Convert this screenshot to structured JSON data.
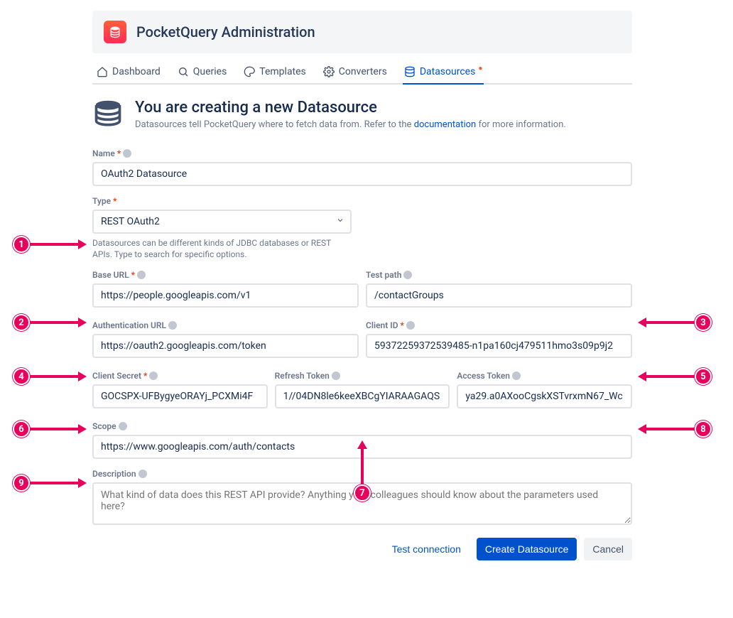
{
  "app": {
    "title": "PocketQuery Administration"
  },
  "tabs": {
    "dashboard": "Dashboard",
    "queries": "Queries",
    "templates": "Templates",
    "converters": "Converters",
    "datasources": "Datasources"
  },
  "intro": {
    "title": "You are creating a new Datasource",
    "sub_pre": "Datasources tell PocketQuery where to fetch data from. Refer to the ",
    "sub_link": "documentation",
    "sub_post": " for more information."
  },
  "labels": {
    "name": "Name",
    "type": "Type",
    "baseurl": "Base URL",
    "testpath": "Test path",
    "authurl": "Authentication URL",
    "clientid": "Client ID",
    "clientsecret": "Client Secret",
    "refreshtoken": "Refresh Token",
    "accesstoken": "Access Token",
    "scope": "Scope",
    "description": "Description"
  },
  "values": {
    "name": "OAuth2 Datasource",
    "type": "REST OAuth2",
    "type_help": "Datasources can be different kinds of JDBC databases or REST APIs. Type to search for specific options.",
    "baseurl": "https://people.googleapis.com/v1",
    "testpath": "/contactGroups",
    "authurl": "https://oauth2.googleapis.com/token",
    "clientid": "59372259372539485-n1pa160cj479511hmo3s09p9j2",
    "clientsecret": "GOCSPX-UFBygyeORAYj_PCXMi4F",
    "refreshtoken": "1//04DN8le6keeXBCgYIARAAGAQS",
    "accesstoken": "ya29.a0AXooCgskXSTvrxmN67_Wc",
    "scope": "https://www.googleapis.com/auth/contacts",
    "description_placeholder": "What kind of data does this REST API provide? Anything your colleagues should know about the parameters used here?"
  },
  "actions": {
    "test": "Test connection",
    "create": "Create Datasource",
    "cancel": "Cancel"
  },
  "annotations": [
    "1",
    "2",
    "3",
    "4",
    "5",
    "6",
    "7",
    "8",
    "9"
  ]
}
